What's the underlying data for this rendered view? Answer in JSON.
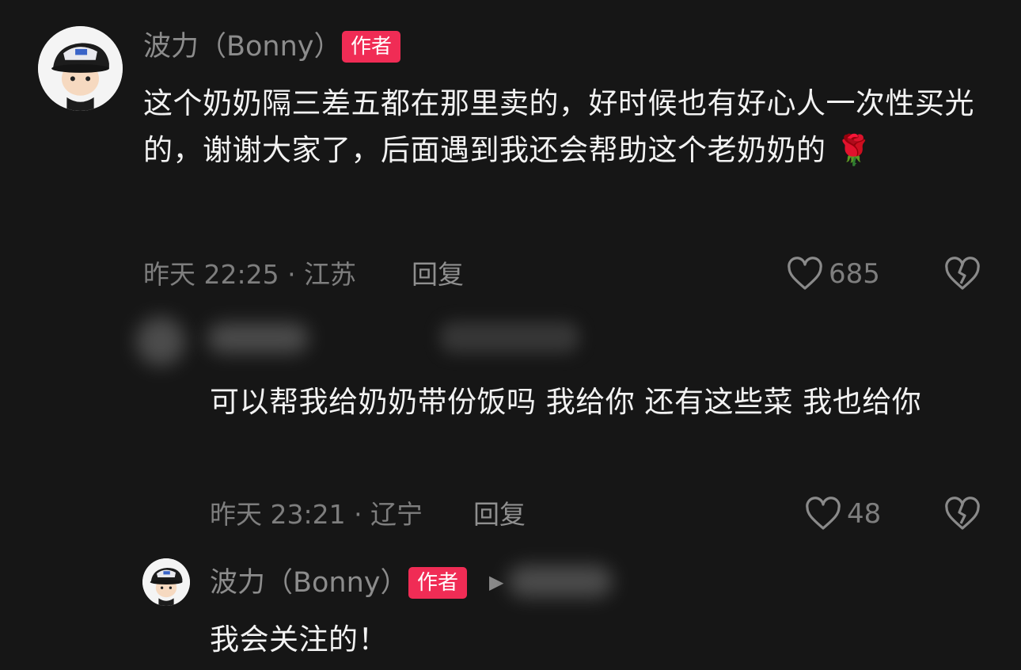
{
  "comment_main": {
    "author": "波力（Bonny）",
    "author_badge": "作者",
    "text": "这个奶奶隔三差五都在那里卖的，好时候也有好心人一次性买光的，谢谢大家了，后面遇到我还会帮助这个老奶奶的 🌹",
    "meta": "昨天 22:25 · 江苏",
    "reply_label": "回复",
    "like_count": "685",
    "icons": {
      "like": "heart-outline-icon",
      "dislike": "broken-heart-icon"
    }
  },
  "reply_1": {
    "author": "",
    "text": "可以帮我给奶奶带份饭吗 我给你 还有这些菜 我也给你",
    "meta": "昨天 23:21 · 辽宁",
    "reply_label": "回复",
    "like_count": "48",
    "icons": {
      "like": "heart-outline-icon",
      "dislike": "broken-heart-icon"
    }
  },
  "reply_2": {
    "author": "波力（Bonny）",
    "author_badge": "作者",
    "reply_to_arrow": "▶",
    "text": "我会关注的！"
  },
  "colors": {
    "background": "#161616",
    "badge": "#f02c55",
    "secondary_text": "#7e7e7e"
  }
}
